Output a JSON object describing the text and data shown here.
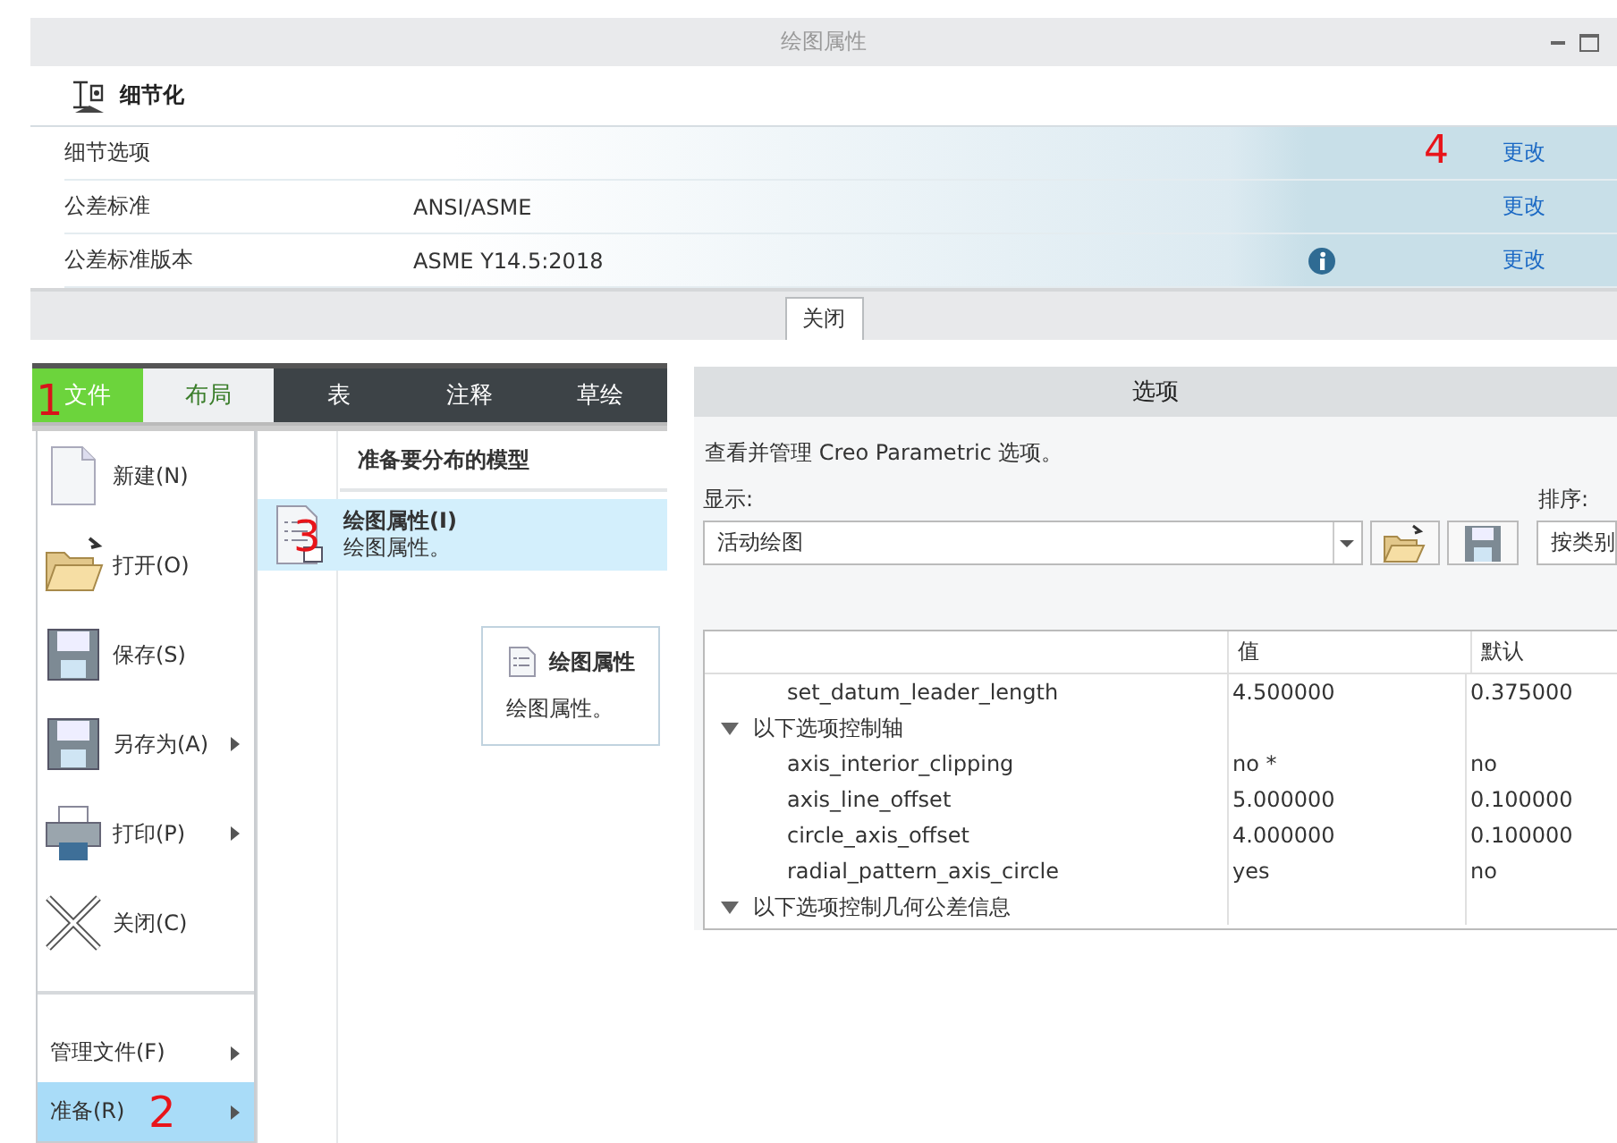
{
  "top_dialog": {
    "title": "绘图属性",
    "section_title": "细节化",
    "rows": [
      {
        "label": "细节选项",
        "action": "更改",
        "info": false,
        "marker": "4"
      },
      {
        "label": "公差标准",
        "value": "ANSI/ASME",
        "action": "更改",
        "info": false
      },
      {
        "label": "公差标准版本",
        "value": "ASME Y14.5:2018",
        "action": "更改",
        "info": true
      }
    ],
    "close_button": "关闭"
  },
  "ribbon": {
    "tabs": [
      {
        "label": "文件",
        "kind": "file",
        "selected": false,
        "marker": "1"
      },
      {
        "label": "布局",
        "kind": "tab",
        "selected": true
      },
      {
        "label": "表",
        "kind": "tab",
        "selected": false
      },
      {
        "label": "注释",
        "kind": "tab",
        "selected": false
      },
      {
        "label": "草绘",
        "kind": "tab",
        "selected": false
      }
    ]
  },
  "file_menu": {
    "items": [
      {
        "label": "新建(N)",
        "kind": "new",
        "submenu": false,
        "selected": false
      },
      {
        "label": "打开(O)",
        "kind": "open",
        "submenu": false,
        "selected": false
      },
      {
        "label": "保存(S)",
        "kind": "save",
        "submenu": false,
        "selected": false
      },
      {
        "label": "另存为(A)",
        "kind": "saveas",
        "submenu": true,
        "selected": false
      },
      {
        "label": "打印(P)",
        "kind": "print",
        "submenu": true,
        "selected": false
      },
      {
        "label": "关闭(C)",
        "kind": "close",
        "submenu": false,
        "selected": false
      }
    ],
    "bottom_items": [
      {
        "label": "管理文件(F)",
        "submenu": true,
        "selected": false
      },
      {
        "label": "准备(R)",
        "submenu": true,
        "selected": true,
        "marker": "2"
      }
    ]
  },
  "submenu": {
    "heading": "准备要分布的模型",
    "items": [
      {
        "title": "绘图属性(I)",
        "description": "绘图属性。",
        "selected": true,
        "marker": "3"
      }
    ]
  },
  "tooltip": {
    "title": "绘图属性",
    "description": "绘图属性。"
  },
  "options_dialog": {
    "title": "选项",
    "description": "查看并管理 Creo Parametric 选项。",
    "show_label": "显示:",
    "show_value": "活动绘图",
    "sort_label": "排序:",
    "sort_value": "按类别",
    "columns": [
      "值",
      "默认"
    ],
    "rows": [
      {
        "kind": "option",
        "name": "set_datum_leader_length",
        "value": "4.500000",
        "default": "0.375000"
      },
      {
        "kind": "group",
        "name": "以下选项控制轴",
        "expanded": true
      },
      {
        "kind": "option",
        "name": "axis_interior_clipping",
        "value": "no *",
        "default": "no"
      },
      {
        "kind": "option",
        "name": "axis_line_offset",
        "value": "5.000000",
        "default": "0.100000"
      },
      {
        "kind": "option",
        "name": "circle_axis_offset",
        "value": "4.000000",
        "default": "0.100000"
      },
      {
        "kind": "option",
        "name": "radial_pattern_axis_circle",
        "value": "yes",
        "default": "no"
      },
      {
        "kind": "group",
        "name": "以下选项控制几何公差信息",
        "expanded": true
      }
    ]
  }
}
